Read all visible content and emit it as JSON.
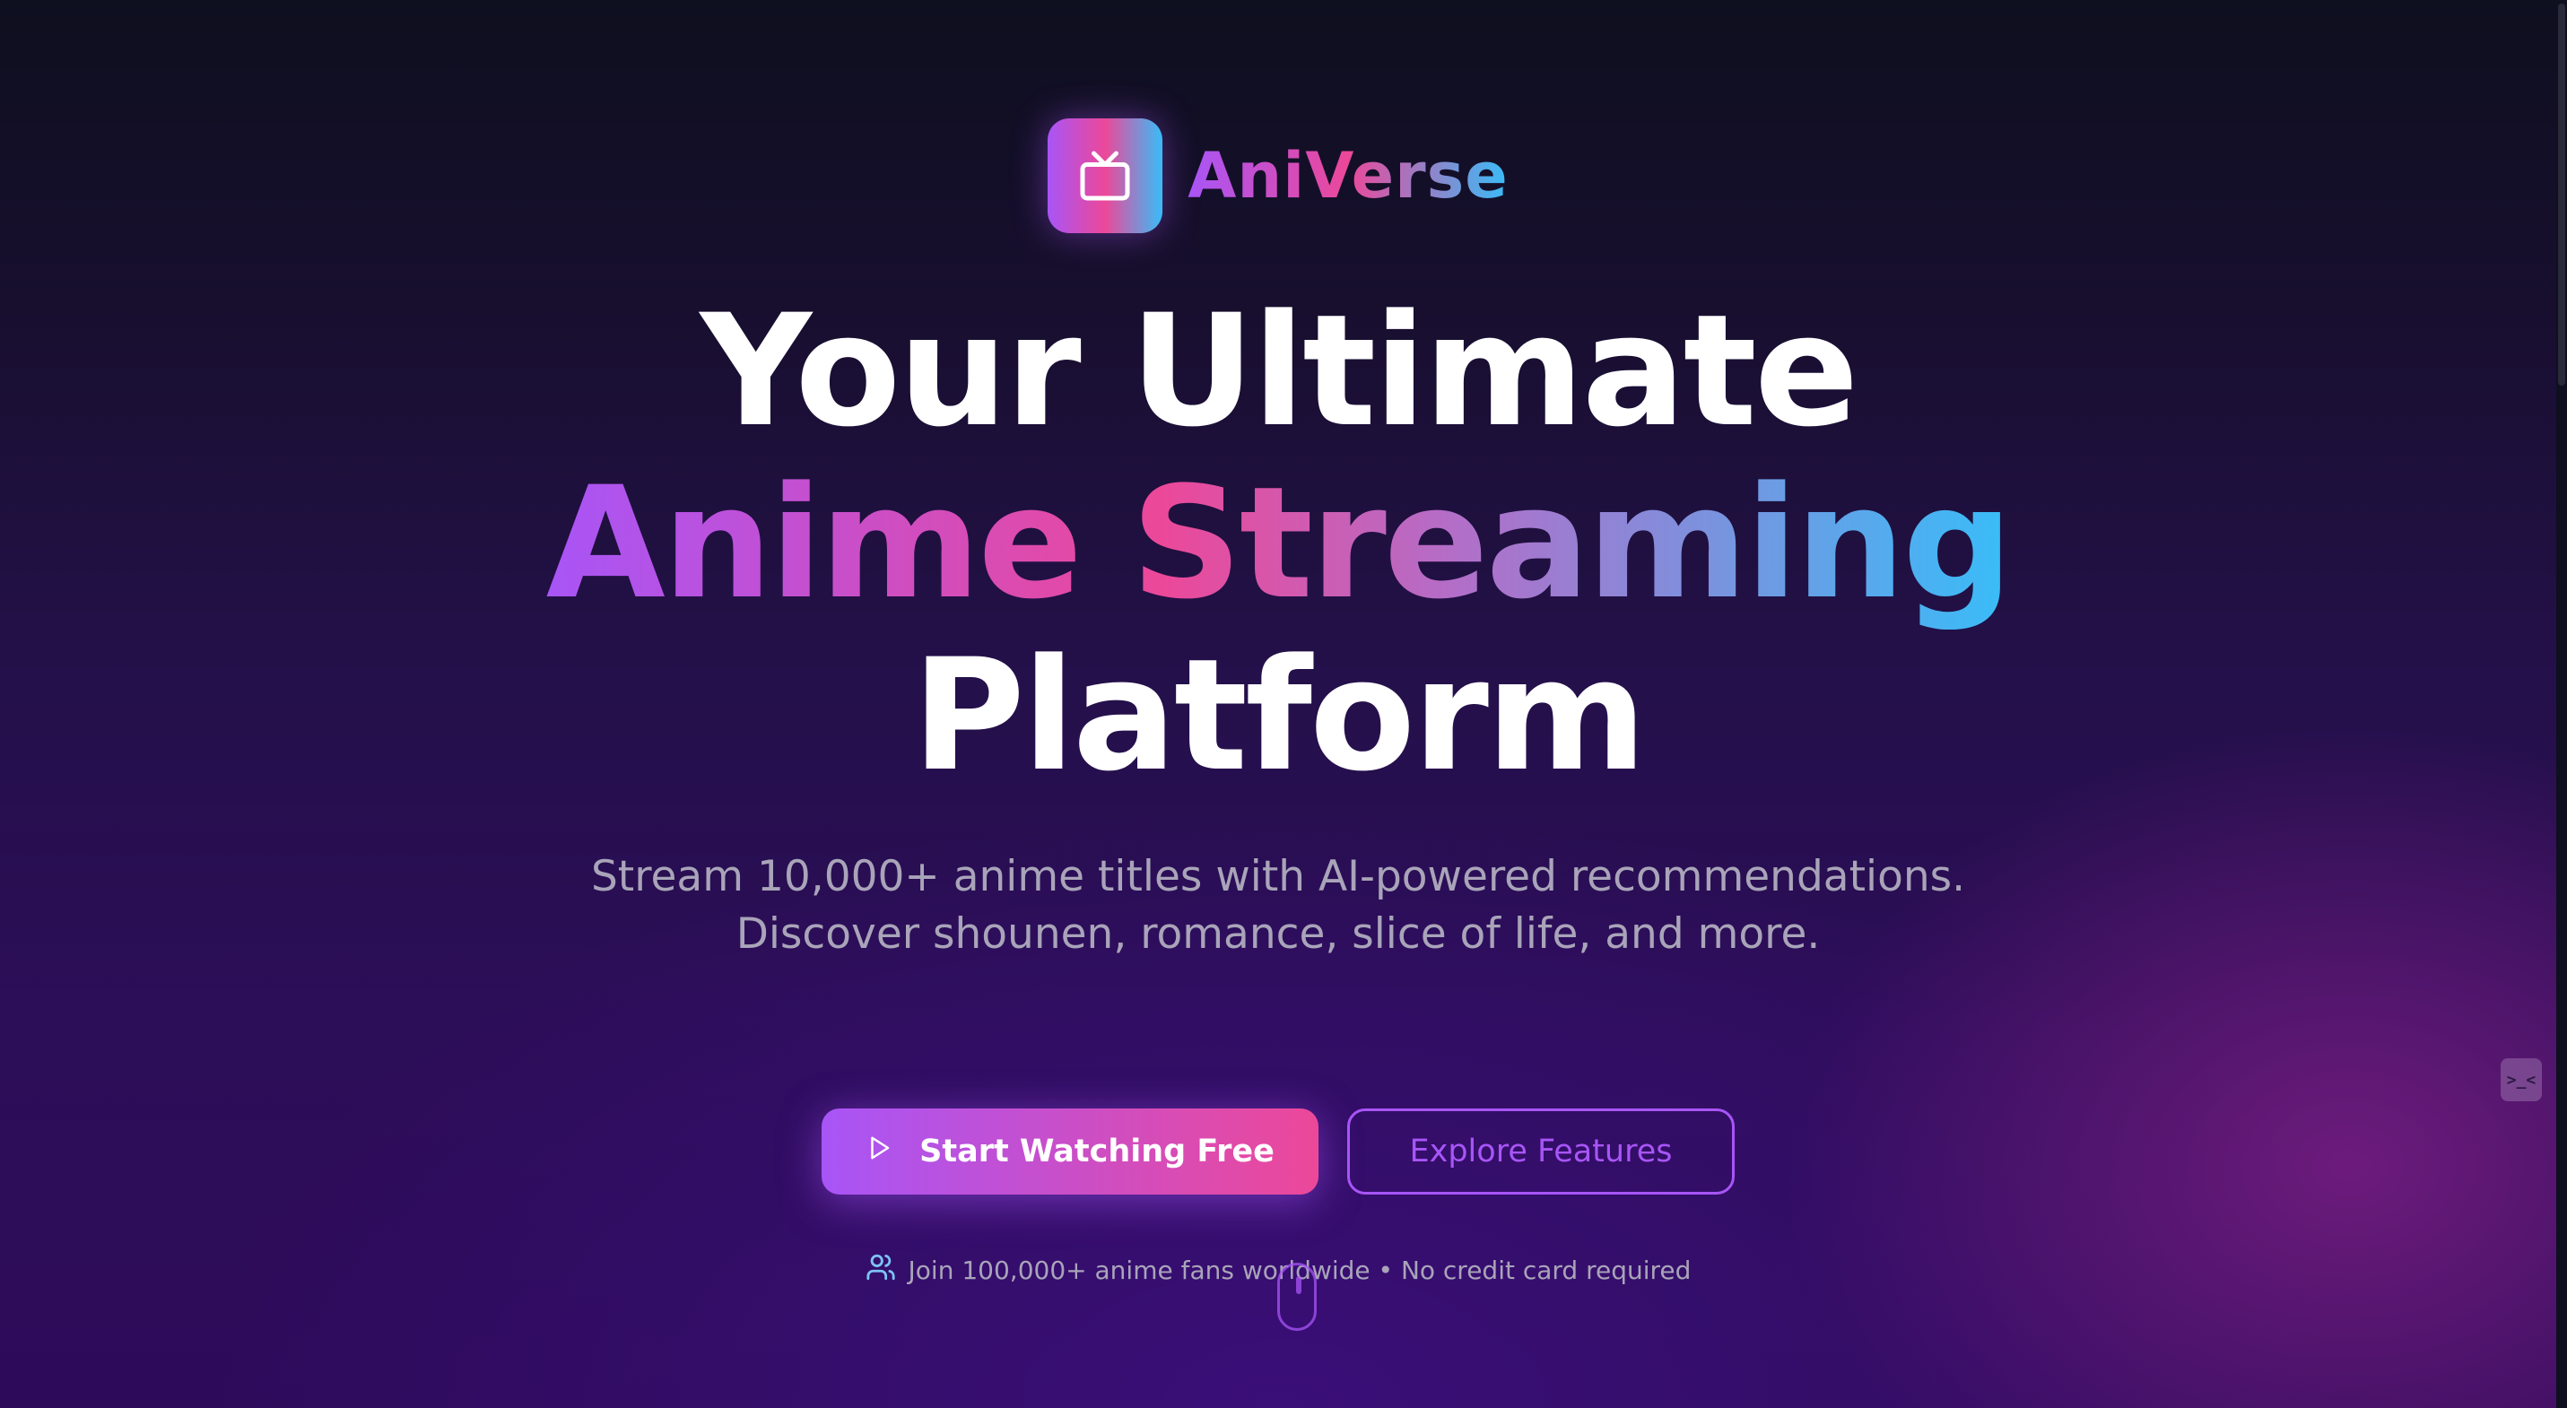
{
  "brand": {
    "name": "AniVerse",
    "icon": "tv-icon",
    "gradient": [
      "#a855f7",
      "#ec4899",
      "#38bdf8"
    ]
  },
  "hero": {
    "headline_line1": "Your Ultimate",
    "headline_line2": "Anime Streaming",
    "headline_line3": "Platform",
    "subtitle": "Stream 10,000+ anime titles with AI-powered recommendations. Discover shounen, romance, slice of life, and more."
  },
  "actions": {
    "primary_label": "Start Watching Free",
    "primary_icon": "play-icon",
    "secondary_label": "Explore Features"
  },
  "social_proof": {
    "icon": "users-icon",
    "text": "Join 100,000+ anime fans worldwide • No credit card required"
  },
  "widgets": {
    "side_widget_label": ">_<",
    "scroll_indicator_icon": "mouse-scroll-icon"
  },
  "colors": {
    "accent_purple": "#a855f7",
    "accent_pink": "#ec4899",
    "accent_cyan": "#38bdf8",
    "text_muted": "#a9a4b9"
  }
}
